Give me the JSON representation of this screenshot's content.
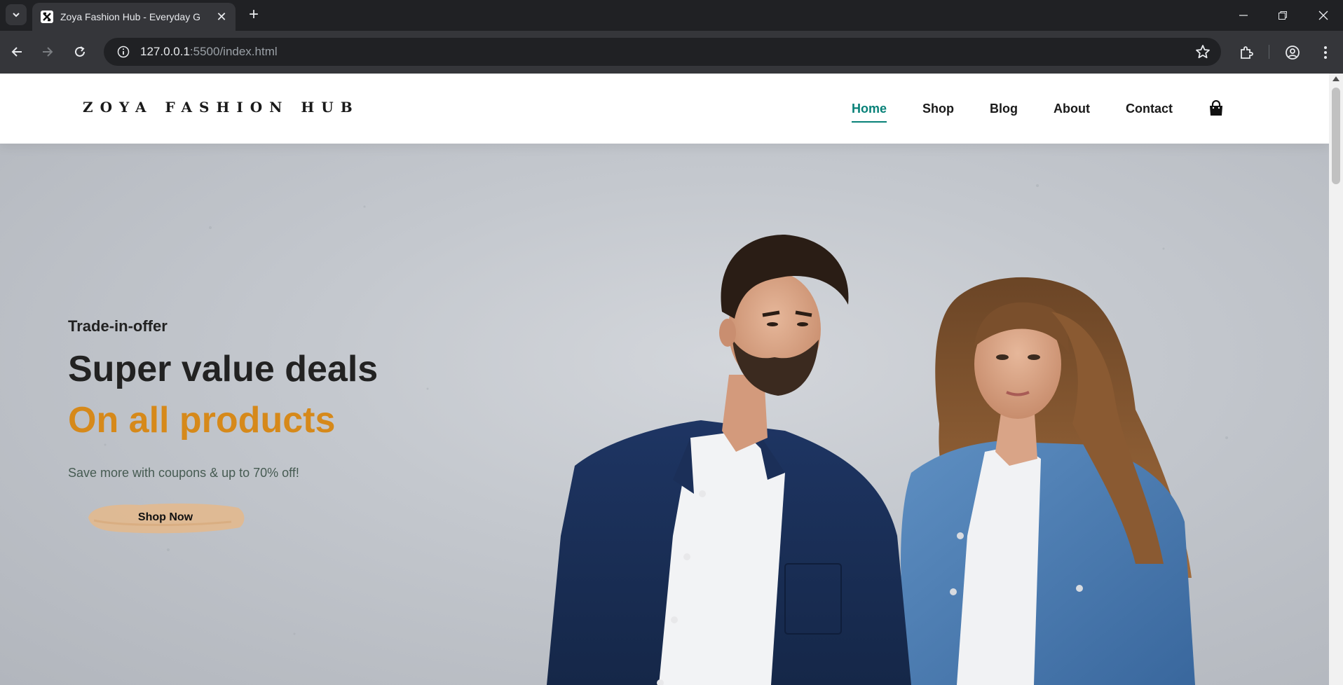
{
  "browser": {
    "tab_title": "Zoya Fashion Hub - Everyday G",
    "url_host": "127.0.0.1",
    "url_rest": ":5500/index.html",
    "icons": [
      "tab-search-icon",
      "close-icon",
      "plus-icon",
      "minimize-icon",
      "restore-icon",
      "window-close-icon",
      "back-icon",
      "forward-icon",
      "reload-icon",
      "info-icon",
      "star-icon",
      "extensions-icon",
      "profile-icon",
      "more-icon"
    ]
  },
  "header": {
    "logo": "ZOYA FASHION HUB",
    "nav": [
      {
        "label": "Home",
        "active": true
      },
      {
        "label": "Shop"
      },
      {
        "label": "Blog"
      },
      {
        "label": "About"
      },
      {
        "label": "Contact"
      }
    ],
    "cart_icon": "shopping-bag-icon"
  },
  "hero": {
    "kicker": "Trade-in-offer",
    "headline": "Super value deals",
    "headline_accent": "On all products",
    "subtext": "Save more with coupons & up to 70% off!",
    "cta_label": "Shop Now"
  },
  "colors": {
    "accent": "#088178",
    "headline_accent": "#d6891a",
    "cta_brush": "#e2b98e"
  }
}
